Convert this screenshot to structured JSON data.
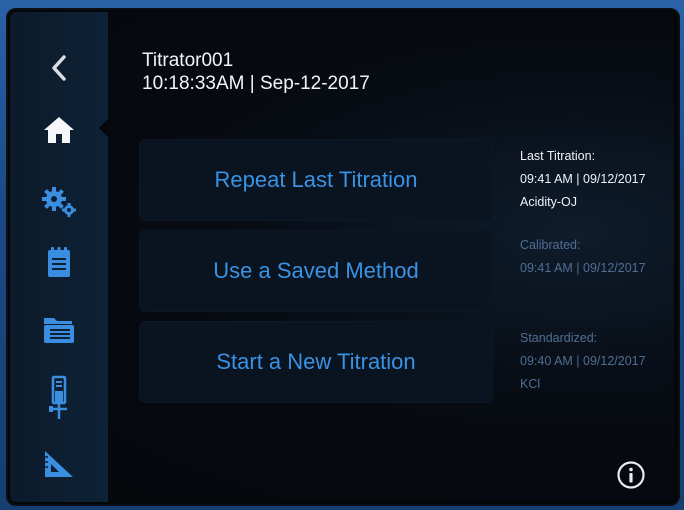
{
  "header": {
    "device_name": "Titrator001",
    "datetime": "10:18:33AM | Sep-12-2017"
  },
  "sidebar": {
    "items": [
      {
        "icon": "back-chevron-icon",
        "active": false
      },
      {
        "icon": "home-icon",
        "active": true
      },
      {
        "icon": "gears-icon",
        "active": false
      },
      {
        "icon": "notepad-icon",
        "active": false
      },
      {
        "icon": "folders-icon",
        "active": false
      },
      {
        "icon": "burette-icon",
        "active": false
      },
      {
        "icon": "triangle-ruler-icon",
        "active": false
      }
    ]
  },
  "actions": {
    "repeat_last": "Repeat Last Titration",
    "use_saved": "Use a Saved Method",
    "start_new": "Start a New Titration"
  },
  "status": {
    "last_titration": {
      "label": "Last Titration:",
      "time": "09:41 AM | 09/12/2017",
      "detail": "Acidity-OJ"
    },
    "calibrated": {
      "label": "Calibrated:",
      "time": "09:41 AM | 09/12/2017"
    },
    "standardized": {
      "label": "Standardized:",
      "time": "09:40 AM | 09/12/2017",
      "detail": "KCl"
    }
  },
  "colors": {
    "accent": "#3a92e3",
    "sidebar_icon": "#3a8ee0",
    "text_primary": "#f2f4f7",
    "text_dim": "#4f6e92"
  },
  "info_icon": "info-circle-icon"
}
